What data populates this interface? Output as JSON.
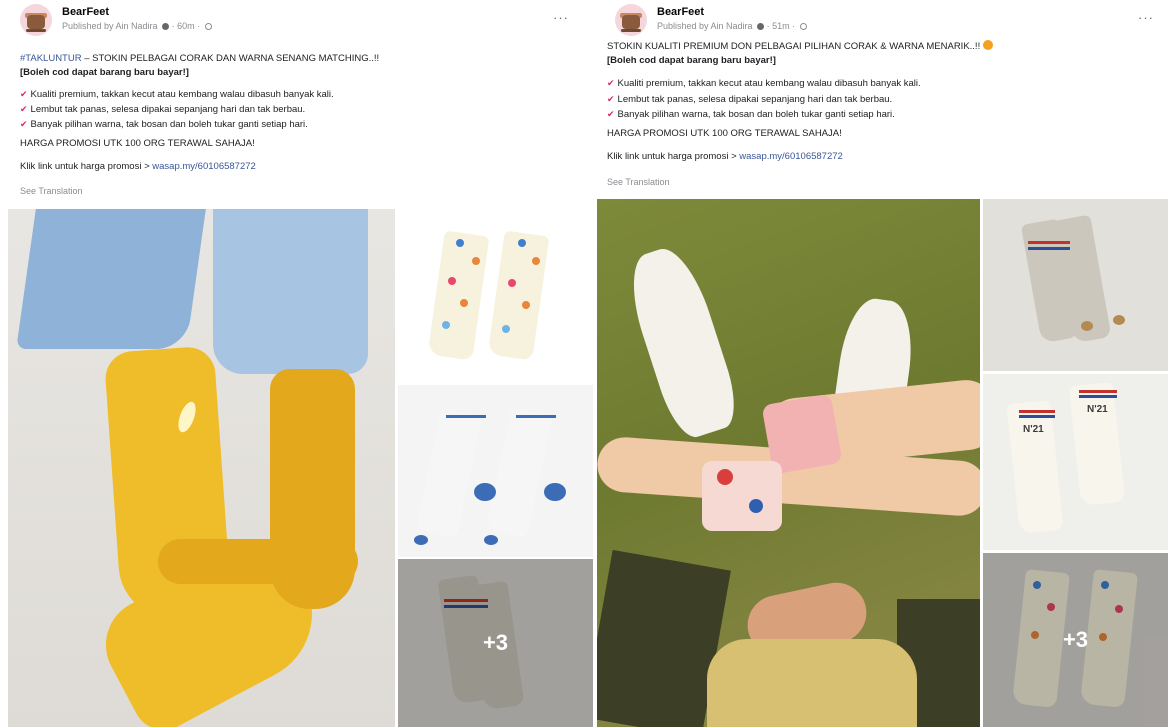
{
  "posts": [
    {
      "page_name": "BearFeet",
      "published_by": "Published by Ain Nadira",
      "time": "60m",
      "more": "···",
      "line1_hashtag": "#TAKLUNTUR",
      "line1_rest": " – STOKIN PELBAGAI CORAK DAN WARNA SENANG MATCHING..!!",
      "line2": "[Boleh cod dapat barang baru bayar!]",
      "bullets": [
        "Kualiti premium, takkan kecut atau kembang walau dibasuh banyak kali.",
        "Lembut tak panas, selesa dipakai sepanjang hari dan tak berbau.",
        "Banyak pilihan warna, tak bosan dan boleh tukar ganti setiap hari."
      ],
      "promo": "HARGA PROMOSI UTK 100 ORG TERAWAL SAHAJA!",
      "link_prefix": "Klik link untuk harga promosi > ",
      "link": "wasap.my/60106587272",
      "see_translation": "See Translation",
      "more_photos": "+3"
    },
    {
      "page_name": "BearFeet",
      "published_by": "Published by Ain Nadira",
      "time": "51m",
      "more": "···",
      "line1": "STOKIN KUALITI PREMIUM DON PELBAGAI PILIHAN CORAK & WARNA MENARIK..!!",
      "line2": "[Boleh cod dapat barang baru bayar!]",
      "bullets": [
        "Kualiti premium, takkan kecut atau kembang walau dibasuh banyak kali.",
        "Lembut tak panas, selesa dipakai sepanjang hari dan tak berbau.",
        "Banyak pilihan warna, tak bosan dan boleh tukar ganti setiap hari."
      ],
      "promo": "HARGA PROMOSI UTK 100 ORG TERAWAL SAHAJA!",
      "link_prefix": "Klik link untuk harga promosi > ",
      "link": "wasap.my/60106587272",
      "see_translation": "See Translation",
      "sock_text": "N'21",
      "more_photos": "+3"
    }
  ],
  "icons": {
    "bullet": "pushpin-icon",
    "verified": "verified-dot-icon",
    "audience": "globe-icon"
  },
  "colors": {
    "link": "#385898",
    "bullet": "#e0245e",
    "meta": "#8a8d91"
  }
}
